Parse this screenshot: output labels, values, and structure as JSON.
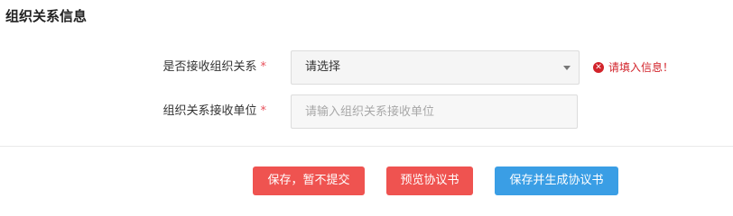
{
  "section": {
    "title": "组织关系信息"
  },
  "form": {
    "receive": {
      "label": "是否接收组织关系",
      "required_mark": "*",
      "selected_value": "请选择",
      "error_icon": "close-circle-icon",
      "error_text": "请填入信息！"
    },
    "unit": {
      "label": "组织关系接收单位",
      "required_mark": "*",
      "value": "",
      "placeholder": "请输入组织关系接收单位"
    }
  },
  "actions": {
    "save_draft": "保存，暂不提交",
    "preview": "预览协议书",
    "save_generate": "保存并生成协议书"
  },
  "colors": {
    "danger_button": "#ef5350",
    "primary_button": "#3a9ee5",
    "error_text": "#d2232a",
    "required_mark": "#e8505b"
  }
}
